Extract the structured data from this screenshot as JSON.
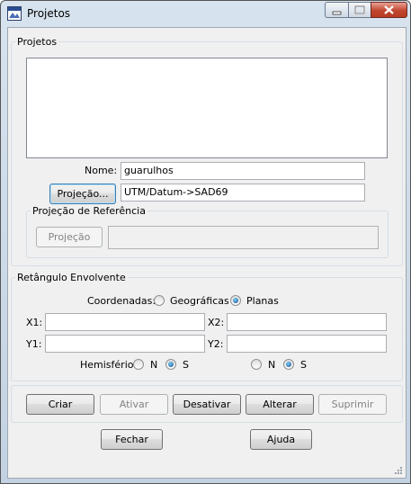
{
  "window": {
    "title": "Projetos"
  },
  "projetos_group": {
    "legend": "Projetos",
    "nome_label": "Nome:",
    "nome_value": "guarulhos",
    "projecao_button": "Projeção...",
    "projecao_value": "UTM/Datum->SAD69",
    "referencia_legend": "Projeção de Referência",
    "referencia_button": "Projeção",
    "referencia_value": ""
  },
  "retangulo_group": {
    "legend": "Retângulo Envolvente",
    "coordenadas_label": "Coordenadas:",
    "coord_options": [
      "Geográficas",
      "Planas"
    ],
    "coord_selected": "Planas",
    "x1_label": "X1:",
    "x2_label": "X2:",
    "y1_label": "Y1:",
    "y2_label": "Y2:",
    "x1_value": "",
    "x2_value": "",
    "y1_value": "",
    "y2_value": "",
    "hemisferio_label": "Hemisfério:",
    "hemisferio_left": {
      "options": [
        "N",
        "S"
      ],
      "selected": "S"
    },
    "hemisferio_right": {
      "options": [
        "N",
        "S"
      ],
      "selected": "S"
    }
  },
  "actions": {
    "criar": "Criar",
    "ativar": "Ativar",
    "desativar": "Desativar",
    "alterar": "Alterar",
    "suprimir": "Suprimir"
  },
  "footer": {
    "fechar": "Fechar",
    "ajuda": "Ajuda"
  },
  "colors": {
    "titlebar": "#c3d2e2",
    "client": "#f0f0f0",
    "close_button": "#c1452f",
    "radio_dot": "#18468f"
  }
}
